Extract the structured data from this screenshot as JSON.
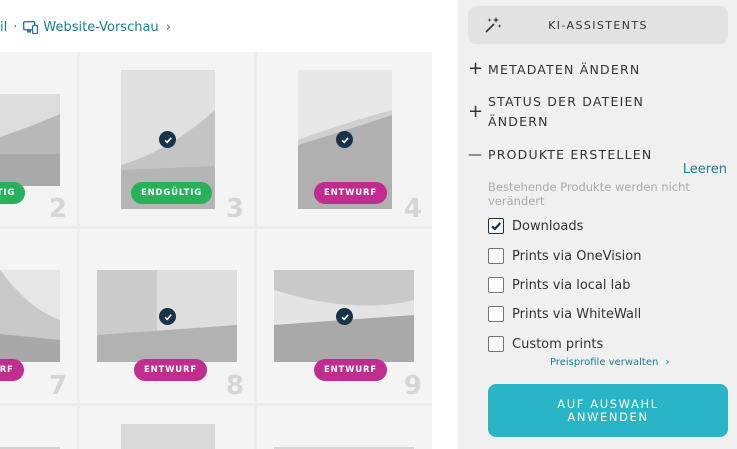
{
  "breadcrumb": {
    "prev_partial": "il",
    "separator": "·",
    "current": "Website-Vorschau",
    "chevron": "›"
  },
  "grid": {
    "cells": [
      {
        "id": "c2",
        "number": "2",
        "status": "ENDGÜLTIG",
        "status_partial": "LTIG",
        "status_type": "final",
        "checked": false,
        "icon": "building-photo"
      },
      {
        "id": "c3",
        "number": "3",
        "status": "ENDGÜLTIG",
        "status_type": "final",
        "checked": true,
        "icon": "building-photo"
      },
      {
        "id": "c4",
        "number": "4",
        "status": "ENTWURF",
        "status_type": "draft",
        "checked": true,
        "icon": "building-photo"
      },
      {
        "id": "c7",
        "number": "7",
        "status": "ENTWURF",
        "status_partial": "URF",
        "status_type": "draft",
        "checked": false,
        "icon": "building-photo"
      },
      {
        "id": "c8",
        "number": "8",
        "status": "ENTWURF",
        "status_type": "draft",
        "checked": true,
        "icon": "building-photo"
      },
      {
        "id": "c9",
        "number": "9",
        "status": "ENTWURF",
        "status_type": "draft",
        "checked": true,
        "icon": "building-photo"
      }
    ]
  },
  "panel": {
    "ai_button": "KI-ASSISTENTS",
    "sections": {
      "metadata": {
        "symbol": "+",
        "label": "METADATEN ÄNDERN"
      },
      "status": {
        "symbol": "+",
        "label_line1": "STATUS DER DATEIEN",
        "label_line2": "ÄNDERN"
      },
      "products": {
        "symbol": "—",
        "label": "PRODUKTE ERSTELLEN"
      }
    },
    "clear_link": "Leeren",
    "hint": "Bestehende Produkte werden nicht verändert",
    "options": [
      {
        "label": "Downloads",
        "checked": true
      },
      {
        "label": "Prints via OneVision",
        "checked": false
      },
      {
        "label": "Prints via local lab",
        "checked": false
      },
      {
        "label": "Prints via WhiteWall",
        "checked": false
      },
      {
        "label": "Custom prints",
        "checked": false
      }
    ],
    "price_link": "Preisprofile verwalten",
    "price_chevron": "›",
    "apply_button": "AUF AUSWAHL ANWENDEN"
  },
  "colors": {
    "accent": "#1e7f8e",
    "apply": "#29b5c6",
    "final_badge": "#27b15a",
    "draft_badge": "#c12d8f",
    "check": "#17344a"
  }
}
